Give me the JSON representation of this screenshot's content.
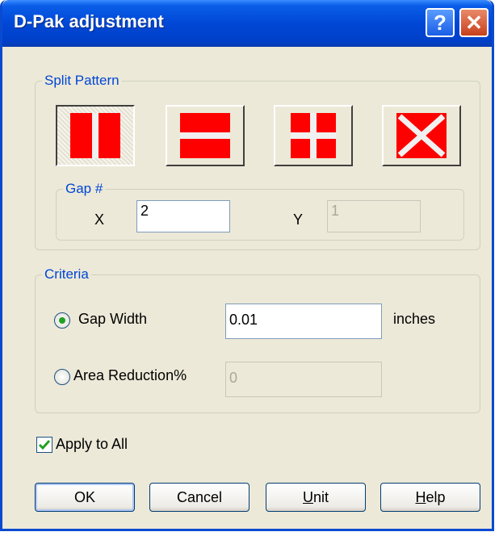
{
  "window": {
    "title": "D-Pak adjustment",
    "help_glyph": "?",
    "close_glyph": "✕"
  },
  "split_pattern": {
    "legend": "Split Pattern",
    "selected": "vertical",
    "patterns": [
      "vertical",
      "horizontal",
      "quad",
      "diagonal-cross"
    ]
  },
  "gap": {
    "legend": "Gap #",
    "x_label": "X",
    "x_value": "2",
    "y_label": "Y",
    "y_value": "1"
  },
  "criteria": {
    "legend": "Criteria",
    "gap_width_label": "Gap Width",
    "gap_width_value": "0.01",
    "gap_width_unit": "inches",
    "area_reduction_label": "Area Reduction%",
    "area_reduction_value": "0",
    "selected": "gap_width"
  },
  "apply_to_all": {
    "label": "Apply to All",
    "checked": true
  },
  "buttons": {
    "ok": "OK",
    "cancel": "Cancel",
    "unit_first": "U",
    "unit_rest": "nit",
    "help_first": "H",
    "help_rest": "elp"
  },
  "colors": {
    "accent": "#0046d5",
    "pattern": "#ff0000"
  }
}
